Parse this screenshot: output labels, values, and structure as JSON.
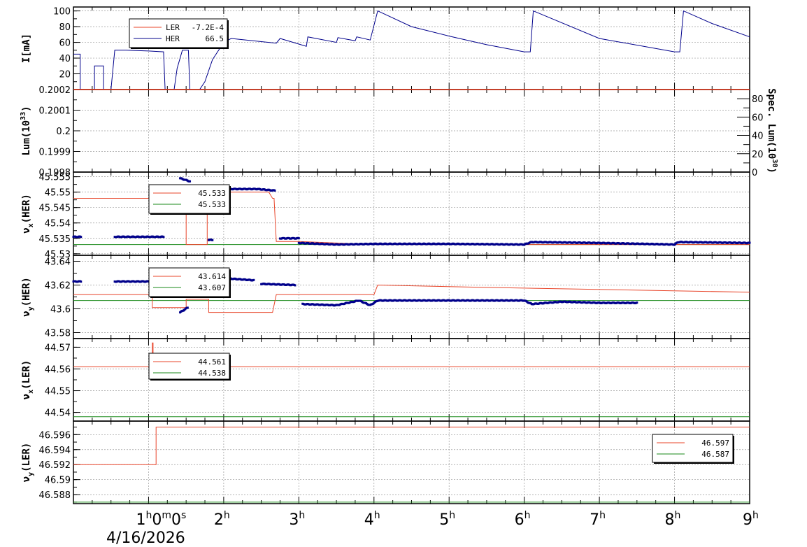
{
  "colors": {
    "ler": "#e8452a",
    "her": "#00008b",
    "ref": "#1a8a1a",
    "grid": "#9a9a9a",
    "bg": "#ffffff"
  },
  "x_axis": {
    "range_hours": [
      0,
      9
    ],
    "ticks": [
      {
        "h": 1,
        "base": "1",
        "sup": "h",
        "extra": "0",
        "extra_sup": "m",
        "extra2": "0",
        "extra2_sup": "s"
      },
      {
        "h": 2,
        "base": "2",
        "sup": "h"
      },
      {
        "h": 3,
        "base": "3",
        "sup": "h"
      },
      {
        "h": 4,
        "base": "4",
        "sup": "h"
      },
      {
        "h": 5,
        "base": "5",
        "sup": "h"
      },
      {
        "h": 6,
        "base": "6",
        "sup": "h"
      },
      {
        "h": 7,
        "base": "7",
        "sup": "h"
      },
      {
        "h": 8,
        "base": "8",
        "sup": "h"
      },
      {
        "h": 9,
        "base": "9",
        "sup": "h"
      }
    ],
    "date": "4/16/2026"
  },
  "chart_data": [
    {
      "type": "line",
      "panel": "current",
      "ylabel": "I[mA]",
      "ylim": [
        0,
        105
      ],
      "yticks": [
        20,
        40,
        60,
        80,
        100
      ],
      "legend": [
        {
          "name": "LER",
          "value": "-7.2E-4"
        },
        {
          "name": "HER",
          "value": "66.5"
        }
      ],
      "series": [
        {
          "name": "LER",
          "points": [
            [
              0,
              0
            ],
            [
              9,
              0
            ]
          ]
        },
        {
          "name": "HER",
          "points": [
            [
              0,
              45
            ],
            [
              0.09,
              45
            ],
            [
              0.09,
              0
            ],
            [
              0.28,
              0
            ],
            [
              0.28,
              30
            ],
            [
              0.4,
              30
            ],
            [
              0.4,
              0
            ],
            [
              0.5,
              0
            ],
            [
              0.55,
              50
            ],
            [
              0.7,
              50
            ],
            [
              1.0,
              49
            ],
            [
              1.2,
              48
            ],
            [
              1.22,
              0
            ],
            [
              1.34,
              0
            ],
            [
              1.38,
              27
            ],
            [
              1.45,
              50
            ],
            [
              1.53,
              50
            ],
            [
              1.55,
              0
            ],
            [
              1.68,
              0
            ],
            [
              1.75,
              10
            ],
            [
              1.85,
              38
            ],
            [
              2.0,
              60
            ],
            [
              2.1,
              65
            ],
            [
              2.7,
              59
            ],
            [
              2.75,
              65
            ],
            [
              3.1,
              55
            ],
            [
              3.12,
              67
            ],
            [
              3.5,
              60
            ],
            [
              3.52,
              66
            ],
            [
              3.75,
              62
            ],
            [
              3.77,
              67
            ],
            [
              3.95,
              63
            ],
            [
              4.05,
              100
            ],
            [
              4.5,
              80
            ],
            [
              5.0,
              68
            ],
            [
              5.5,
              57
            ],
            [
              6.0,
              48
            ],
            [
              6.08,
              48
            ],
            [
              6.12,
              100
            ],
            [
              7.0,
              65
            ],
            [
              8.0,
              48
            ],
            [
              8.07,
              48
            ],
            [
              8.12,
              100
            ],
            [
              8.5,
              84
            ],
            [
              9.0,
              67
            ]
          ]
        }
      ]
    },
    {
      "type": "line",
      "panel": "luminosity",
      "ylabel": "Lum(10^33)",
      "ylabel_parts": {
        "base": "Lum(10",
        "sup": "33",
        "tail": ")"
      },
      "ylim": [
        0.1998,
        0.2002
      ],
      "yticks": [
        "0.1998",
        "0.1999",
        "0.2",
        "0.2001",
        "0.2002"
      ],
      "y2label": "Spec. Lum(10^30)",
      "y2label_parts": {
        "base": "Spec. Lum(10",
        "sup": "30",
        "tail": ")"
      },
      "y2lim": [
        0,
        90
      ],
      "y2ticks": [
        0,
        20,
        40,
        60,
        80
      ],
      "series": [
        {
          "name": "Lum",
          "points": [
            [
              0,
              0.2002
            ],
            [
              9,
              0.2002
            ]
          ]
        }
      ]
    },
    {
      "type": "scatter",
      "panel": "nux_her",
      "ylabel": "νx(HER)",
      "ylabel_parts": {
        "base": "ν",
        "sub": "x",
        "tail": "(HER)"
      },
      "ylim": [
        45.5295,
        45.5565
      ],
      "yticks": [
        "45.53",
        "45.535",
        "45.54",
        "45.545",
        "45.55",
        "45.555"
      ],
      "legend": [
        {
          "name": "set",
          "value": "45.533"
        },
        {
          "name": "ref",
          "value": "45.533"
        }
      ],
      "reference": 45.533,
      "setpoint": [
        [
          0,
          45.548
        ],
        [
          1.2,
          45.548
        ],
        [
          1.2,
          45.544
        ],
        [
          1.32,
          45.544
        ],
        [
          1.32,
          45.548
        ],
        [
          1.5,
          45.548
        ],
        [
          1.5,
          45.533
        ],
        [
          1.78,
          45.533
        ],
        [
          1.78,
          45.548
        ],
        [
          1.85,
          45.548
        ],
        [
          1.85,
          45.55
        ],
        [
          2.6,
          45.55
        ],
        [
          2.65,
          45.548
        ],
        [
          2.67,
          45.548
        ],
        [
          2.7,
          45.534
        ],
        [
          3.0,
          45.534
        ],
        [
          4.0,
          45.533
        ],
        [
          9,
          45.533
        ]
      ],
      "measured_segments": [
        [
          [
            0,
            45.5355
          ],
          [
            0.1,
            45.5355
          ]
        ],
        [
          [
            0.55,
            45.5355
          ],
          [
            1.2,
            45.5355
          ]
        ],
        [
          [
            1.42,
            45.5545
          ],
          [
            1.55,
            45.5535
          ]
        ],
        [
          [
            1.8,
            45.5345
          ],
          [
            1.85,
            45.5345
          ]
        ],
        [
          [
            1.95,
            45.551
          ],
          [
            2.45,
            45.551
          ],
          [
            2.68,
            45.5505
          ]
        ],
        [
          [
            2.75,
            45.535
          ],
          [
            3.0,
            45.535
          ]
        ],
        [
          [
            3.0,
            45.5335
          ],
          [
            3.5,
            45.533
          ],
          [
            4.0,
            45.5332
          ],
          [
            5.0,
            45.5332
          ],
          [
            6.0,
            45.533
          ],
          [
            6.1,
            45.5338
          ],
          [
            7.0,
            45.5335
          ],
          [
            8.0,
            45.533
          ],
          [
            8.05,
            45.5338
          ],
          [
            9,
            45.5335
          ]
        ]
      ]
    },
    {
      "type": "scatter",
      "panel": "nuy_her",
      "ylabel": "νy(HER)",
      "ylabel_parts": {
        "base": "ν",
        "sub": "y",
        "tail": "(HER)"
      },
      "ylim": [
        43.575,
        43.645
      ],
      "yticks": [
        "43.58",
        "43.6",
        "43.62",
        "43.64"
      ],
      "legend": [
        {
          "name": "set",
          "value": "43.614"
        },
        {
          "name": "ref",
          "value": "43.607"
        }
      ],
      "reference": 43.607,
      "setpoint": [
        [
          0,
          43.612
        ],
        [
          1.05,
          43.612
        ],
        [
          1.05,
          43.601
        ],
        [
          1.35,
          43.601
        ],
        [
          1.5,
          43.601
        ],
        [
          1.5,
          43.608
        ],
        [
          1.8,
          43.608
        ],
        [
          1.8,
          43.597
        ],
        [
          2.65,
          43.597
        ],
        [
          2.7,
          43.612
        ],
        [
          4.0,
          43.612
        ],
        [
          4.05,
          43.62
        ],
        [
          5.5,
          43.618
        ],
        [
          9,
          43.614
        ]
      ],
      "measured_segments": [
        [
          [
            0,
            43.623
          ],
          [
            0.1,
            43.623
          ]
        ],
        [
          [
            0.55,
            43.623
          ],
          [
            1.2,
            43.623
          ]
        ],
        [
          [
            1.42,
            43.597
          ],
          [
            1.52,
            43.601
          ]
        ],
        [
          [
            1.95,
            43.626
          ],
          [
            2.4,
            43.624
          ]
        ],
        [
          [
            2.5,
            43.621
          ],
          [
            2.95,
            43.62
          ]
        ],
        [
          [
            3.05,
            43.604
          ],
          [
            3.5,
            43.603
          ],
          [
            3.8,
            43.607
          ],
          [
            3.95,
            43.603
          ],
          [
            4.05,
            43.607
          ],
          [
            5.0,
            43.607
          ],
          [
            6.0,
            43.607
          ],
          [
            6.1,
            43.604
          ],
          [
            6.5,
            43.606
          ],
          [
            7.0,
            43.605
          ],
          [
            7.5,
            43.605
          ]
        ]
      ]
    },
    {
      "type": "line",
      "panel": "nux_ler",
      "ylabel": "νx(LER)",
      "ylabel_parts": {
        "base": "ν",
        "sub": "x",
        "tail": "(LER)"
      },
      "ylim": [
        44.536,
        44.574
      ],
      "yticks": [
        "44.54",
        "44.55",
        "44.56",
        "44.57"
      ],
      "legend": [
        {
          "name": "set",
          "value": "44.561"
        },
        {
          "name": "ref",
          "value": "44.538"
        }
      ],
      "reference": 44.538,
      "setpoint": [
        [
          0,
          44.561
        ],
        [
          1.05,
          44.561
        ],
        [
          1.05,
          44.572
        ],
        [
          1.06,
          44.572
        ],
        [
          1.06,
          44.561
        ],
        [
          9,
          44.561
        ]
      ]
    },
    {
      "type": "line",
      "panel": "nuy_ler",
      "ylabel": "νy(LER)",
      "ylabel_parts": {
        "base": "ν",
        "sub": "y",
        "tail": "(LER)"
      },
      "ylim": [
        46.5868,
        46.5978
      ],
      "yticks": [
        "46.588",
        "46.59",
        "46.592",
        "46.594",
        "46.596"
      ],
      "legend": [
        {
          "name": "set",
          "value": "46.597"
        },
        {
          "name": "ref",
          "value": "46.587"
        }
      ],
      "reference": 46.587,
      "setpoint": [
        [
          0,
          46.592
        ],
        [
          1.1,
          46.592
        ],
        [
          1.1,
          46.597
        ],
        [
          9,
          46.597
        ]
      ]
    }
  ]
}
